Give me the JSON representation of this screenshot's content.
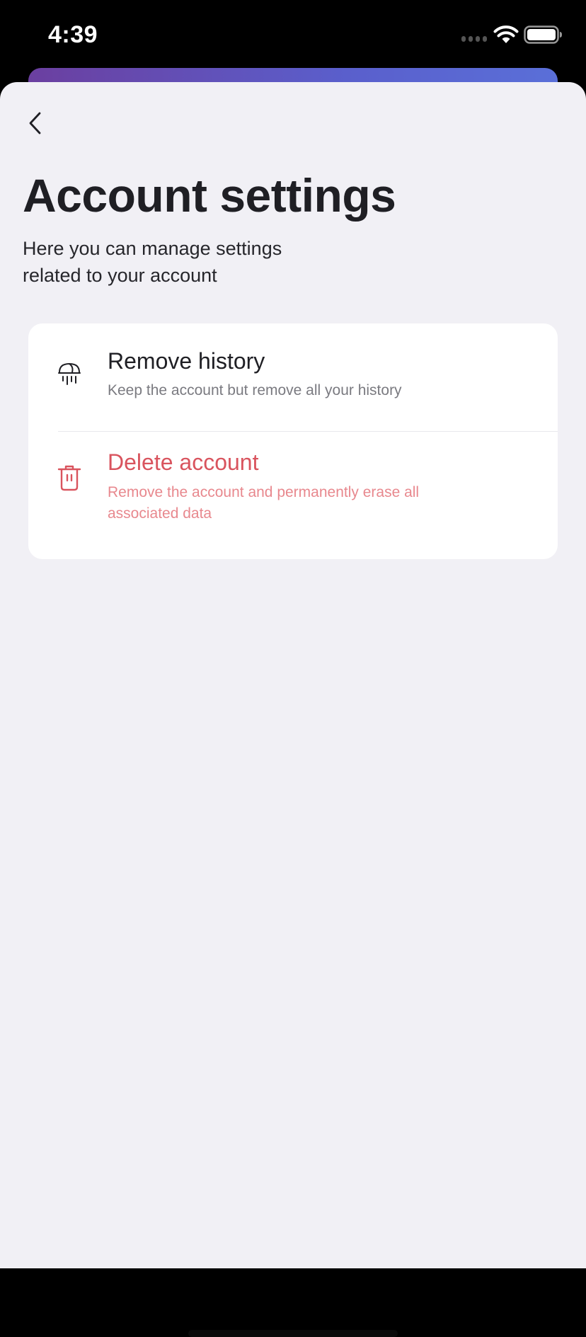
{
  "status_bar": {
    "time": "4:39"
  },
  "header": {
    "back_icon": "chevron-left-icon",
    "title": "Account settings",
    "subtitle": "Here you can manage settings related to your account"
  },
  "options": [
    {
      "icon": "shredder-icon",
      "title": "Remove history",
      "description": "Keep the account but remove all your history"
    },
    {
      "icon": "trash-icon",
      "title": "Delete account",
      "description": "Remove the account and permanently erase all associated data"
    }
  ],
  "colors": {
    "background": "#f1f0f5",
    "card": "#ffffff",
    "text_primary": "#1f1f24",
    "text_secondary": "#7a7a80",
    "danger": "#d9545e",
    "danger_light": "#e8888e",
    "gradient_start": "#6b3fa0",
    "gradient_end": "#5a6fd8"
  }
}
